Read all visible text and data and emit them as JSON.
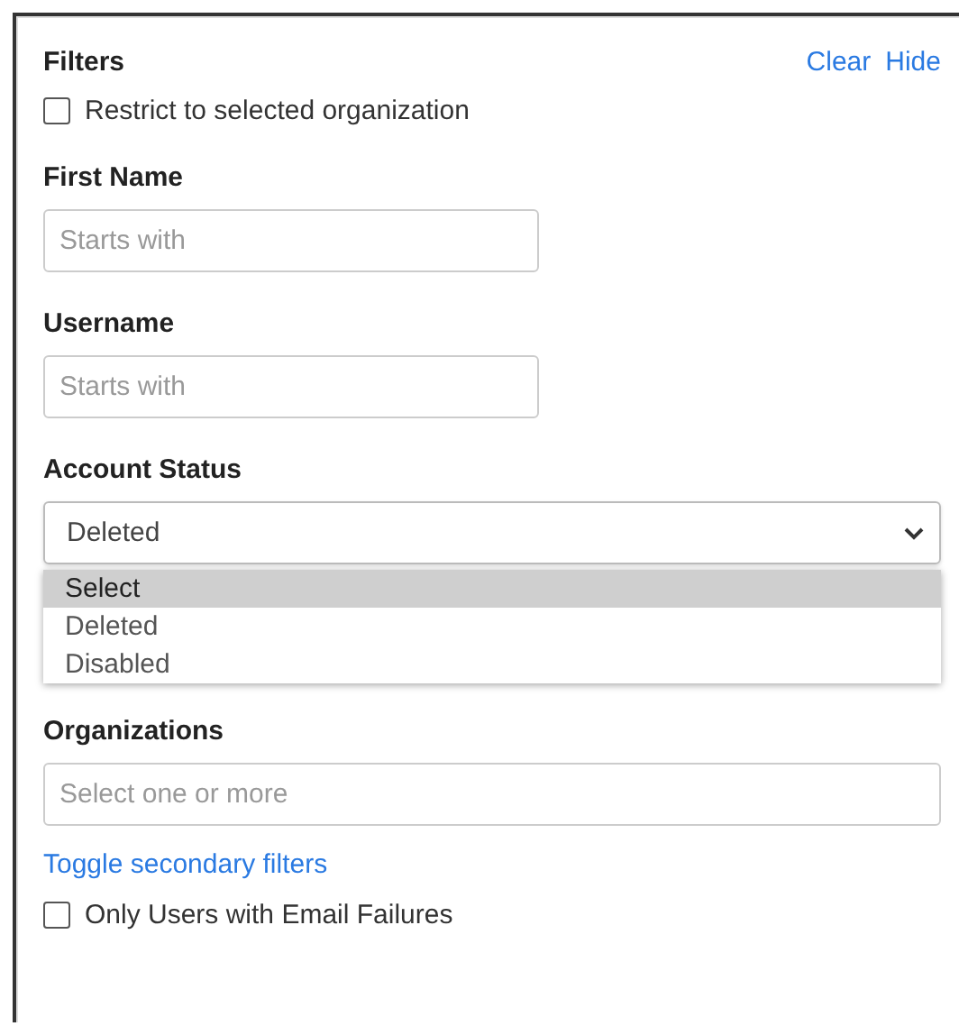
{
  "header": {
    "title": "Filters",
    "actions": [
      "Clear",
      "Hide"
    ]
  },
  "restrict": {
    "label": "Restrict to selected organization",
    "checked": false
  },
  "fields": [
    {
      "kind": "text",
      "label": "First Name",
      "placeholder": "Starts with"
    },
    {
      "kind": "text",
      "label": "Username",
      "placeholder": "Starts with"
    },
    {
      "kind": "select",
      "label": "Account Status",
      "value": "Deleted",
      "expanded": true,
      "options": [
        {
          "label": "Select",
          "highlighted": true
        },
        {
          "label": "Deleted",
          "highlighted": false
        },
        {
          "label": "Disabled",
          "highlighted": false
        }
      ]
    },
    {
      "kind": "multi",
      "label": "Organizations",
      "placeholder": "Select one or more"
    }
  ],
  "toggle_link": "Toggle secondary filters",
  "email_failures": {
    "label": "Only Users with Email Failures",
    "checked": false
  }
}
